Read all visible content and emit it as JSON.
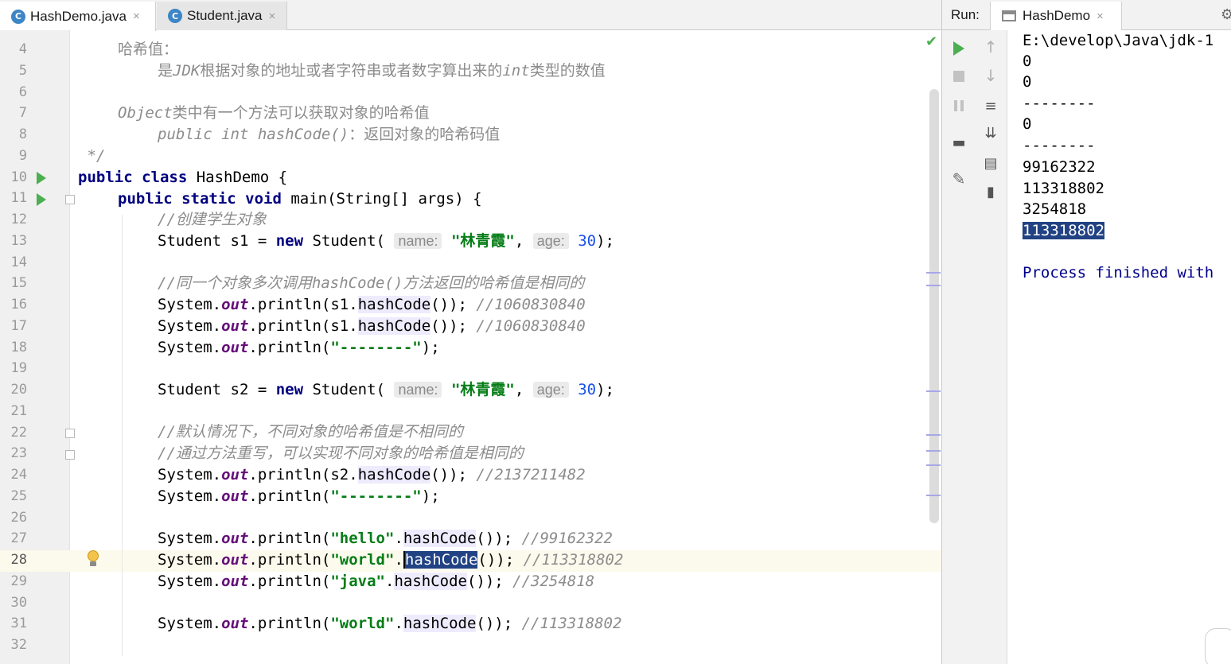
{
  "editor": {
    "tabs": [
      {
        "label": "HashDemo.java",
        "icon": "C",
        "close": "×"
      },
      {
        "label": "Student.java",
        "icon": "C",
        "close": "×"
      }
    ],
    "line_numbers": [
      "4",
      "5",
      "6",
      "7",
      "8",
      "9",
      "10",
      "11",
      "12",
      "13",
      "14",
      "15",
      "16",
      "17",
      "18",
      "19",
      "20",
      "21",
      "22",
      "23",
      "24",
      "25",
      "26",
      "27",
      "28",
      "29",
      "30",
      "31",
      "32"
    ],
    "current_line": "28",
    "code": {
      "l4": "哈希值：",
      "l5_a": "是",
      "l5_b": "JDK",
      "l5_c": "根据对象的地址或者字符串或者数字算出来的",
      "l5_d": "int",
      "l5_e": "类型的数值",
      "l7_a": "Object",
      "l7_b": "类中有一个方法可以获取对象的哈希值",
      "l8_a": "public int hashCode()",
      "l8_b": "：返回对象的哈希码值",
      "l9": " */",
      "l10_kw": "public class",
      "l10_rest": " HashDemo {",
      "l11_kw": "public static void",
      "l11_rest": " main(String[] args) {",
      "l12": "//创建学生对象",
      "l13_a": "Student s1 = ",
      "l13_kw": "new",
      "l13_b": " Student(",
      "l13_hint1": "name:",
      "l13_str": "\"林青霞\"",
      "l13_c": ", ",
      "l13_hint2": "age:",
      "l13_num": "30",
      "l13_d": ");",
      "l15_a": "//同一个对象多次调用",
      "l15_b": "hashCode()",
      "l15_c": "方法返回的哈希值是相同的",
      "l16_a": "System.",
      "l16_out": "out",
      "l16_b": ".println(s1.",
      "l16_m": "hashCode",
      "l16_c": "()); ",
      "l16_cmt": "//1060830840",
      "l17_a": "System.",
      "l17_out": "out",
      "l17_b": ".println(s1.",
      "l17_m": "hashCode",
      "l17_c": "()); ",
      "l17_cmt": "//1060830840",
      "l18_a": "System.",
      "l18_out": "out",
      "l18_b": ".println(",
      "l18_str": "\"--------\"",
      "l18_c": ");",
      "l20_a": "Student s2 = ",
      "l20_kw": "new",
      "l20_b": " Student(",
      "l20_hint1": "name:",
      "l20_str": "\"林青霞\"",
      "l20_c": ", ",
      "l20_hint2": "age:",
      "l20_num": "30",
      "l20_d": ");",
      "l22": "//默认情况下，不同对象的哈希值是不相同的",
      "l23": "//通过方法重写，可以实现不同对象的哈希值是相同的",
      "l24_a": "System.",
      "l24_out": "out",
      "l24_b": ".println(s2.",
      "l24_m": "hashCode",
      "l24_c": "()); ",
      "l24_cmt": "//2137211482",
      "l25_a": "System.",
      "l25_out": "out",
      "l25_b": ".println(",
      "l25_str": "\"--------\"",
      "l25_c": ");",
      "l27_a": "System.",
      "l27_out": "out",
      "l27_b": ".println(",
      "l27_str": "\"hello\"",
      "l27_dot": ".",
      "l27_m": "hashCode",
      "l27_c": "()); ",
      "l27_cmt": "//99162322",
      "l28_a": "System.",
      "l28_out": "out",
      "l28_b": ".println(",
      "l28_str": "\"world\"",
      "l28_dot": ".",
      "l28_m": "hashCode",
      "l28_c": "()); ",
      "l28_cmt": "//113318802",
      "l29_a": "System.",
      "l29_out": "out",
      "l29_b": ".println(",
      "l29_str": "\"java\"",
      "l29_dot": ".",
      "l29_m": "hashCode",
      "l29_c": "()); ",
      "l29_cmt": "//3254818",
      "l31_a": "System.",
      "l31_out": "out",
      "l31_b": ".println(",
      "l31_str": "\"world\"",
      "l31_dot": ".",
      "l31_m": "hashCode",
      "l31_c": "()); ",
      "l31_cmt": "//113318802"
    },
    "inspection_status": "✔"
  },
  "run": {
    "label": "Run:",
    "tab_label": "HashDemo",
    "tab_close": "×",
    "gear": "⚙",
    "toolbar_icons": [
      "rerun-icon",
      "stop-icon",
      "pause-icon",
      "soft-wrap-icon",
      "scroll-to-end-icon",
      "layout-icon",
      "print-icon",
      "pin-icon",
      "trash-icon",
      "up-arrow-icon",
      "down-arrow-icon"
    ],
    "output": [
      "E:\\develop\\Java\\jdk-1",
      "0",
      "0",
      "--------",
      "0",
      "--------",
      "99162322",
      "113318802",
      "3254818",
      "113318802",
      "",
      "Process finished with"
    ]
  },
  "colors": {
    "keyword": "#000080",
    "string": "#067d17",
    "number": "#1750eb",
    "comment": "#8c8c8c",
    "static_field": "#660e7a",
    "selection": "#214283",
    "current_line": "#fcfaed",
    "run_green": "#4caf50",
    "process_text": "#00008b"
  }
}
